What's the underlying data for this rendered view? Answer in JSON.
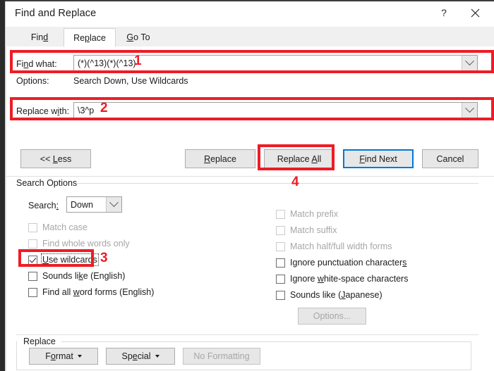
{
  "window": {
    "title": "Find and Replace",
    "help_icon": "question-mark-icon",
    "close_icon": "close-icon"
  },
  "tabs": [
    {
      "label": "Find",
      "accel": "d",
      "active": false
    },
    {
      "label": "Replace",
      "accel": "p",
      "active": true
    },
    {
      "label": "Go To",
      "accel": "G",
      "active": false
    }
  ],
  "find": {
    "label": "Find what:",
    "value": "(*)(^13)(*)(^13)",
    "placeholder": "",
    "dropdown_icon": "chevron-down-icon"
  },
  "options_line": {
    "label": "Options:",
    "value": "Search Down, Use Wildcards"
  },
  "replace": {
    "label": "Replace with:",
    "value": "\\3^p",
    "placeholder": "",
    "dropdown_icon": "chevron-down-icon"
  },
  "buttons": {
    "less": "<< Less",
    "replace": "Replace",
    "replace_all": "Replace All",
    "find_next": "Find Next",
    "cancel": "Cancel"
  },
  "search_options": {
    "title": "Search Options",
    "search_label": "Search:",
    "search_value": "Down",
    "search_dropdown_icon": "chevron-down-icon",
    "left_checkboxes": [
      {
        "label": "Match case",
        "checked": false,
        "disabled": true
      },
      {
        "label": "Find whole words only",
        "checked": false,
        "disabled": true
      },
      {
        "label": "Use wildcards",
        "checked": true,
        "disabled": false,
        "focused": true
      },
      {
        "label": "Sounds like (English)",
        "checked": false,
        "disabled": false
      },
      {
        "label": "Find all word forms (English)",
        "checked": false,
        "disabled": false
      }
    ],
    "right_checkboxes": [
      {
        "label": "Match prefix",
        "checked": false,
        "disabled": true
      },
      {
        "label": "Match suffix",
        "checked": false,
        "disabled": true
      },
      {
        "label": "Match half/full width forms",
        "checked": false,
        "disabled": true
      },
      {
        "label": "Ignore punctuation characters",
        "checked": false,
        "disabled": false
      },
      {
        "label": "Ignore white-space characters",
        "checked": false,
        "disabled": false
      },
      {
        "label": "Sounds like (Japanese)",
        "checked": false,
        "disabled": false
      }
    ],
    "options_button": "Options...",
    "options_button_disabled": true
  },
  "replace_group": {
    "title": "Replace",
    "format_button": "Format",
    "special_button": "Special",
    "no_formatting_button": "No Formatting",
    "no_formatting_disabled": true
  },
  "annotations": [
    {
      "number": "1",
      "target": "find-what-field"
    },
    {
      "number": "2",
      "target": "replace-with-field"
    },
    {
      "number": "3",
      "target": "use-wildcards-checkbox"
    },
    {
      "number": "4",
      "target": "replace-all-button"
    }
  ],
  "colors": {
    "annotation_red": "#ee1c25",
    "focus_blue": "#0078d7",
    "dialog_bg": "#ffffff",
    "button_bg": "#e7e7e7",
    "tab_strip_bg": "#f0f0f0",
    "disabled_text": "#a6a6a6"
  }
}
